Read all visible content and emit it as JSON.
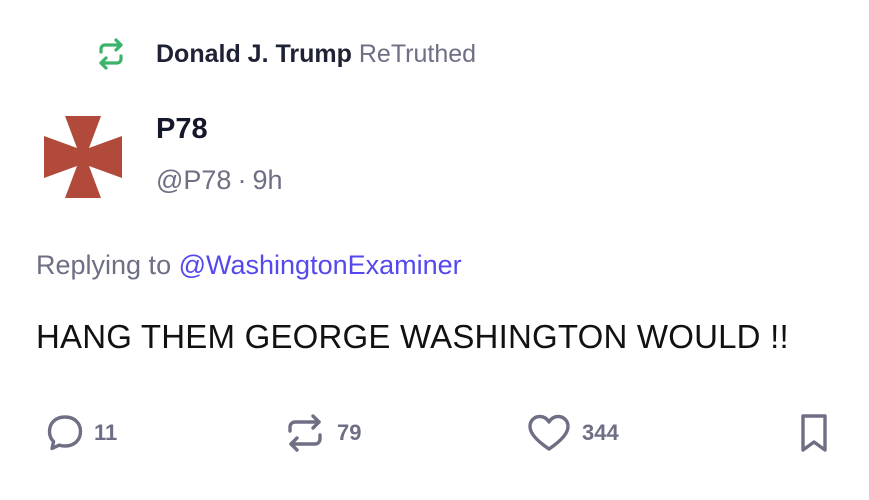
{
  "colors": {
    "retruth_icon": "#3bb36a",
    "avatar_cross": "#b24a3b",
    "mention": "#5448ee",
    "muted": "#6e6f84",
    "text": "#111111"
  },
  "retruth_banner": {
    "icon": "retruth-arrows-icon",
    "name": "Donald J. Trump",
    "verb": "ReTruthed"
  },
  "author": {
    "avatar_icon": "cross-pattee-icon",
    "display_name": "P78",
    "handle": "@P78",
    "separator": "·",
    "time": "9h"
  },
  "reply": {
    "prefix": "Replying to",
    "mention": "@WashingtonExaminer"
  },
  "post_text": "HANG THEM GEORGE WASHINGTON WOULD !!",
  "actions": {
    "replies": {
      "icon": "speech-bubble-icon",
      "count": "11"
    },
    "retruths": {
      "icon": "retruth-icon",
      "count": "79"
    },
    "likes": {
      "icon": "heart-icon",
      "count": "344"
    },
    "bookmark": {
      "icon": "bookmark-icon"
    }
  }
}
